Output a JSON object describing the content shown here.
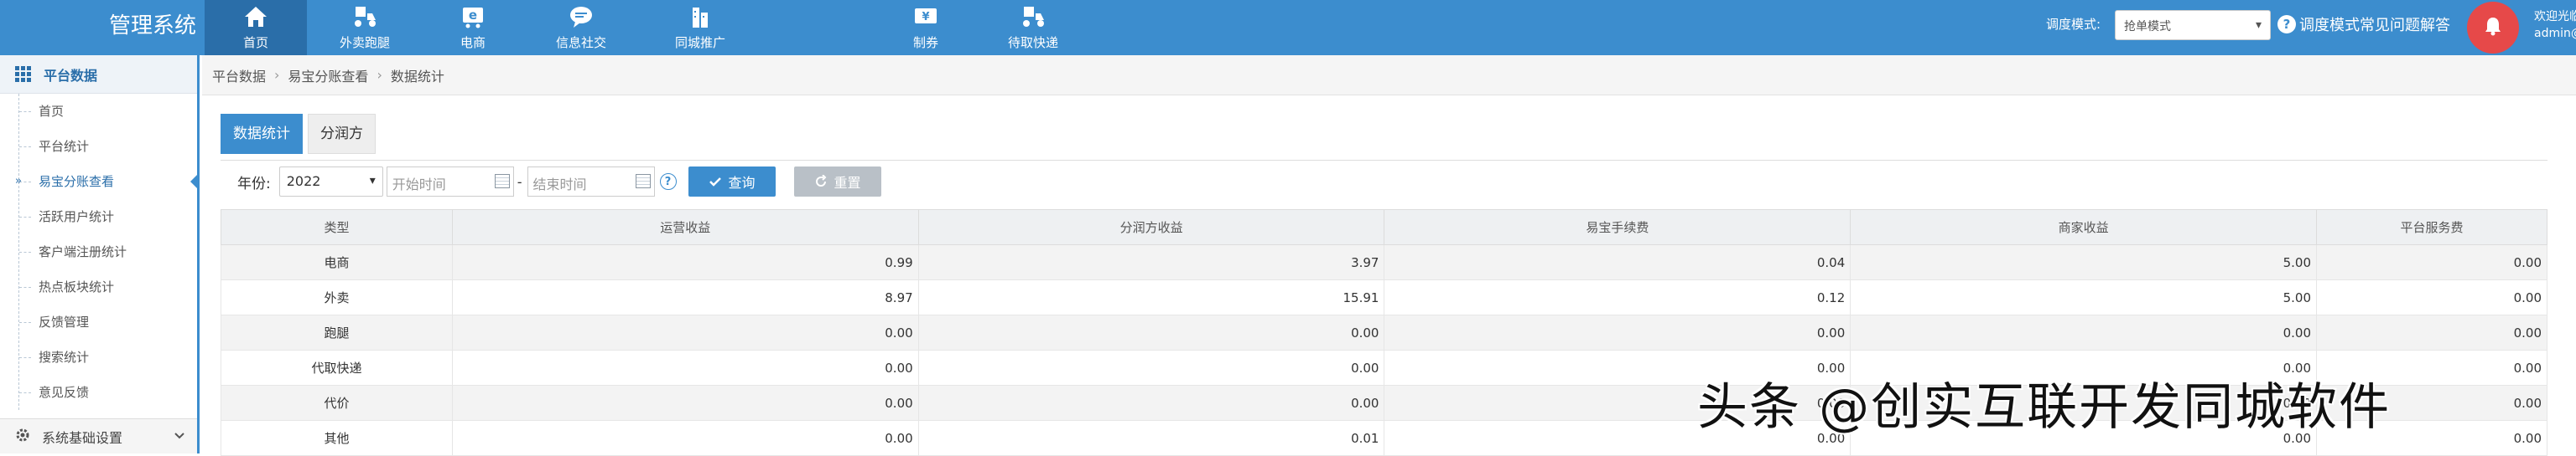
{
  "app": {
    "brand": "管理系统"
  },
  "topnav": [
    {
      "label": "首页",
      "icon": "home-icon",
      "active": true
    },
    {
      "label": "外卖跑腿",
      "icon": "delivery-icon",
      "active": false
    },
    {
      "label": "电商",
      "icon": "ecommerce-icon",
      "active": false
    },
    {
      "label": "信息社交",
      "icon": "chat-icon",
      "active": false
    },
    {
      "label": "同城推广",
      "icon": "building-icon",
      "active": false
    },
    {
      "label": "制券",
      "icon": "coupon-icon",
      "active": false
    },
    {
      "label": "待取快递",
      "icon": "express-icon",
      "active": false
    }
  ],
  "header_right": {
    "mode_label": "调度模式:",
    "mode_value": "抢单模式",
    "help_label": "调度模式常见问题解答",
    "user_line1": "欢迎光临",
    "user_line2": "admin@"
  },
  "sidebar": {
    "section_title": "平台数据",
    "items": [
      {
        "label": "首页",
        "active": false
      },
      {
        "label": "平台统计",
        "active": false
      },
      {
        "label": "易宝分账查看",
        "active": true
      },
      {
        "label": "活跃用户统计",
        "active": false
      },
      {
        "label": "客户端注册统计",
        "active": false
      },
      {
        "label": "热点板块统计",
        "active": false
      },
      {
        "label": "反馈管理",
        "active": false
      },
      {
        "label": "搜索统计",
        "active": false
      },
      {
        "label": "意见反馈",
        "active": false
      }
    ],
    "footer_title": "系统基础设置"
  },
  "breadcrumb": [
    "平台数据",
    "易宝分账查看",
    "数据统计"
  ],
  "tabs": [
    {
      "label": "数据统计",
      "active": true
    },
    {
      "label": "分润方",
      "active": false
    }
  ],
  "filter": {
    "year_label": "年份:",
    "year_value": "2022",
    "start_placeholder": "开始时间",
    "range_sep": "-",
    "end_placeholder": "结束时间",
    "query_label": "查询",
    "reset_label": "重置"
  },
  "table": {
    "columns": [
      "类型",
      "运营收益",
      "分润方收益",
      "易宝手续费",
      "商家收益",
      "平台服务费"
    ],
    "rows": [
      [
        "电商",
        "0.99",
        "3.97",
        "0.04",
        "5.00",
        "0.00"
      ],
      [
        "外卖",
        "8.97",
        "15.91",
        "0.12",
        "5.00",
        "0.00"
      ],
      [
        "跑腿",
        "0.00",
        "0.00",
        "0.00",
        "0.00",
        "0.00"
      ],
      [
        "代取快递",
        "0.00",
        "0.00",
        "0.00",
        "0.00",
        "0.00"
      ],
      [
        "代价",
        "0.00",
        "0.00",
        "0.00",
        "0.00",
        "0.00"
      ],
      [
        "其他",
        "0.00",
        "0.01",
        "0.00",
        "0.00",
        "0.00"
      ]
    ]
  },
  "watermark": "头条 @创实互联开发同城软件",
  "colors": {
    "primary": "#3c8dce",
    "primary_dark": "#2a6ea9",
    "bell": "#e64949"
  }
}
